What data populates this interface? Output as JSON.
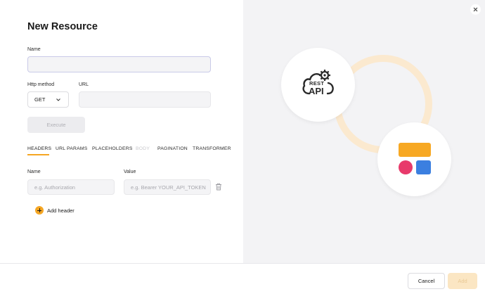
{
  "modal": {
    "title": "New Resource",
    "close_icon": "close-icon"
  },
  "form": {
    "name_label": "Name",
    "name_value": "",
    "http_method_label": "Http method",
    "http_method_value": "GET",
    "url_label": "URL",
    "url_value": "",
    "execute_label": "Execute"
  },
  "tabs": [
    {
      "label": "HEADERS",
      "active": true,
      "disabled": false
    },
    {
      "label": "URL PARAMS",
      "active": false,
      "disabled": false
    },
    {
      "label": "PLACEHOLDERS",
      "active": false,
      "disabled": false
    },
    {
      "label": "BODY",
      "active": false,
      "disabled": true
    },
    {
      "label": "PAGINATION",
      "active": false,
      "disabled": false
    },
    {
      "label": "TRANSFORMER",
      "active": false,
      "disabled": false
    }
  ],
  "headers": {
    "name_col": "Name",
    "value_col": "Value",
    "name_placeholder": "e.g. Authorization",
    "value_placeholder": "e.g. Bearer YOUR_API_TOKEN",
    "add_label": "Add header"
  },
  "illustration": {
    "api_icon_top": "REST",
    "api_icon_bottom": "API",
    "colors": {
      "ring": "#fbe9cf",
      "yellow_block": "#f7a823",
      "pink_dot": "#e83a6b",
      "blue_block": "#3b7fe0"
    }
  },
  "footer": {
    "cancel_label": "Cancel",
    "add_label": "Add"
  },
  "colors": {
    "accent": "#f5a623",
    "panel_bg": "#f3f3f5"
  }
}
